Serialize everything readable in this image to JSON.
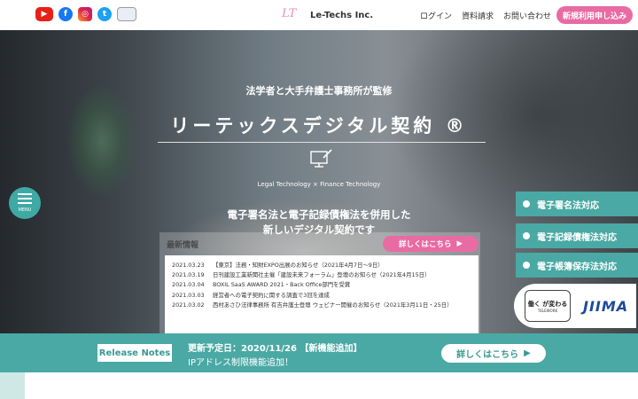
{
  "header": {
    "social": [
      {
        "name": "youtube-icon",
        "glyph": "▶"
      },
      {
        "name": "facebook-icon",
        "glyph": "f"
      },
      {
        "name": "instagram-icon",
        "glyph": "◎"
      },
      {
        "name": "twitter-icon",
        "glyph": "t"
      },
      {
        "name": "building-icon",
        "glyph": "▥"
      }
    ],
    "logo_mark": "LT",
    "logo_text": "Le-Techs Inc.",
    "nav": [
      "ログイン",
      "資料請求",
      "お問い合わせ"
    ],
    "signup_label": "新規利用申し込み"
  },
  "hero": {
    "tagline": "法学者と大手弁護士事務所が監修",
    "product_title": "リーテックスデジタル契約 ®",
    "subtitle_en": "Legal Technology × Finance Technology",
    "lead_line1": "電子署名法と電子記録債権法を併用した",
    "lead_line2": "新しいデジタル契約です"
  },
  "menu_label": "MENU",
  "features": [
    "電子署名法対応",
    "電子記録債権法対応",
    "電子帳簿保存法対応"
  ],
  "badges": {
    "telework_main": "働く  が変わる",
    "telework_sub": "TELEWORK",
    "jiima": "JIIMA"
  },
  "news": {
    "heading": "最新情報",
    "more_label": "詳しくはこちら",
    "more_arrow": "▶",
    "items": [
      {
        "date": "2021.03.23",
        "text": "【東京】法務・知財EXPO出展のお知らせ（2021年4月7日〜9日）"
      },
      {
        "date": "2021.03.19",
        "text": "日刊建設工業新聞社主催「建設未来フォーラム」登壇のお知らせ（2021年4月15日）"
      },
      {
        "date": "2021.03.04",
        "text": "BOXIL SaaS AWARD 2021・Back Office部門を受賞"
      },
      {
        "date": "2021.03.03",
        "text": "経営者への電子契約に関する調査で3冠を達成"
      },
      {
        "date": "2021.03.02",
        "text": "西村あさひ法律事務所 有吉弁護士登壇 ウェビナー開催のお知らせ（2021年3月11日・25日）"
      }
    ]
  },
  "release": {
    "label": "Release Notes",
    "line1": "更新予定日：2020/11/26 【新機能追加】",
    "line2": "IPアドレス制限機能追加！",
    "more_label": "詳しくはこちら",
    "more_arrow": "▶"
  },
  "colors": {
    "teal": "#4aa9a4",
    "pink": "#e96ba3"
  }
}
